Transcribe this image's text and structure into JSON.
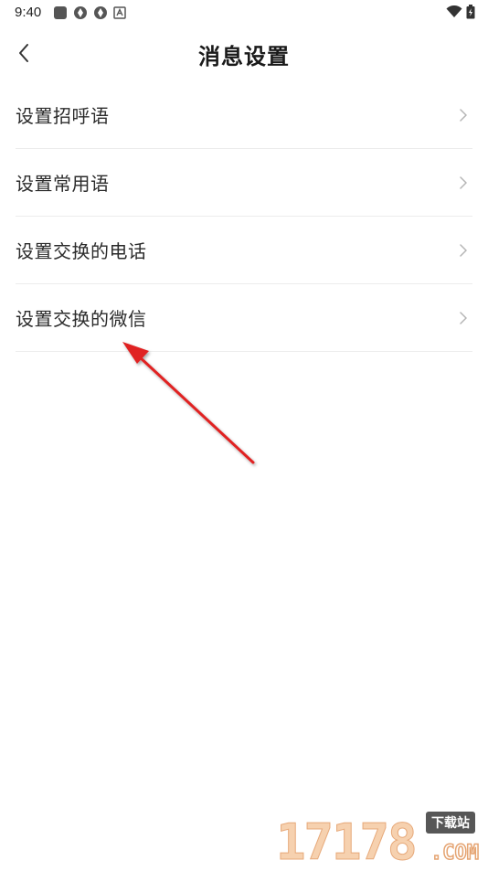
{
  "status_bar": {
    "time": "9:40",
    "left_icons": [
      "app-square-icon",
      "aperture-icon",
      "aperture-icon",
      "notification-a-icon"
    ],
    "right_icons": [
      "wifi-icon",
      "battery-icon"
    ]
  },
  "header": {
    "title": "消息设置",
    "back_icon": "chevron-left-icon"
  },
  "menu": {
    "items": [
      {
        "label": "设置招呼语"
      },
      {
        "label": "设置常用语"
      },
      {
        "label": "设置交换的电话"
      },
      {
        "label": "设置交换的微信"
      }
    ]
  },
  "annotation": {
    "arrow_color": "#e02020"
  },
  "watermark": {
    "digits": "17178",
    "badge": "下载站",
    "suffix": ".COM"
  }
}
